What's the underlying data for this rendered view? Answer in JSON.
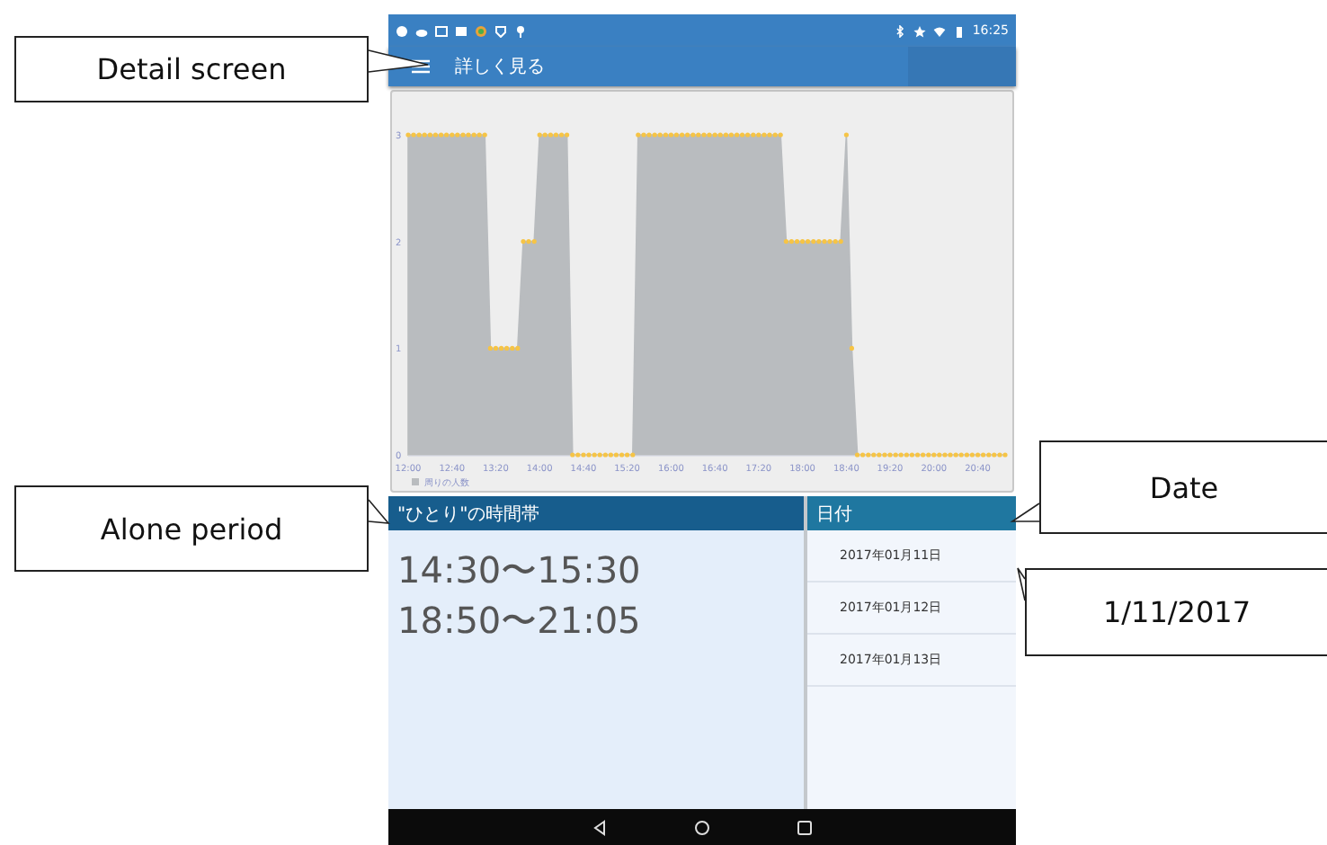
{
  "annotations": [
    {
      "text": "Detail screen"
    },
    {
      "text": "Alone period"
    },
    {
      "text": "Date"
    },
    {
      "text": "1/11/2017"
    }
  ],
  "status_bar": {
    "time": "16:25"
  },
  "app_bar": {
    "title": "詳しく見る"
  },
  "chart": {
    "chart_data": {
      "type": "area",
      "x": [
        720,
        725,
        730,
        735,
        740,
        745,
        750,
        755,
        760,
        765,
        770,
        775,
        780,
        785,
        790,
        795,
        800,
        805,
        810,
        815,
        820,
        825,
        830,
        835,
        840,
        845,
        850,
        855,
        860,
        865,
        870,
        875,
        880,
        885,
        890,
        895,
        900,
        905,
        910,
        915,
        920,
        925,
        930,
        935,
        940,
        945,
        950,
        955,
        960,
        965,
        970,
        975,
        980,
        985,
        990,
        995,
        1000,
        1005,
        1010,
        1015,
        1020,
        1025,
        1030,
        1035,
        1040,
        1045,
        1050,
        1055,
        1060,
        1065,
        1070,
        1075,
        1080,
        1085,
        1090,
        1095,
        1100,
        1105,
        1110,
        1115,
        1120,
        1125,
        1130,
        1135,
        1140,
        1145,
        1150,
        1155,
        1160,
        1165,
        1170,
        1175,
        1180,
        1185,
        1190,
        1195,
        1200,
        1205,
        1210,
        1215,
        1220,
        1225,
        1230,
        1235,
        1240,
        1245,
        1250,
        1255,
        1260,
        1265
      ],
      "series": [
        {
          "name": "周りの人数",
          "color": "#b9bcbf",
          "values": [
            3,
            3,
            3,
            3,
            3,
            3,
            3,
            3,
            3,
            3,
            3,
            3,
            3,
            3,
            3,
            1,
            1,
            1,
            1,
            1,
            1,
            2,
            2,
            2,
            3,
            3,
            3,
            3,
            3,
            3,
            0,
            0,
            0,
            0,
            0,
            0,
            0,
            0,
            0,
            0,
            0,
            0,
            3,
            3,
            3,
            3,
            3,
            3,
            3,
            3,
            3,
            3,
            3,
            3,
            3,
            3,
            3,
            3,
            3,
            3,
            3,
            3,
            3,
            3,
            3,
            3,
            3,
            3,
            3,
            2,
            2,
            2,
            2,
            2,
            2,
            2,
            2,
            2,
            2,
            2,
            3,
            1,
            0,
            0,
            0,
            0,
            0,
            0,
            0,
            0,
            0,
            0,
            0,
            0,
            0,
            0,
            0,
            0,
            0,
            0,
            0,
            0,
            0,
            0,
            0,
            0,
            0,
            0,
            0,
            0
          ]
        }
      ],
      "xlim": [
        720,
        1265
      ],
      "ylim": [
        0,
        3
      ],
      "xticks": [
        {
          "value": 720,
          "label": "12:00"
        },
        {
          "value": 760,
          "label": "12:40"
        },
        {
          "value": 800,
          "label": "13:20"
        },
        {
          "value": 840,
          "label": "14:00"
        },
        {
          "value": 880,
          "label": "14:40"
        },
        {
          "value": 920,
          "label": "15:20"
        },
        {
          "value": 960,
          "label": "16:00"
        },
        {
          "value": 1000,
          "label": "16:40"
        },
        {
          "value": 1040,
          "label": "17:20"
        },
        {
          "value": 1080,
          "label": "18:00"
        },
        {
          "value": 1120,
          "label": "18:40"
        },
        {
          "value": 1160,
          "label": "19:20"
        },
        {
          "value": 1200,
          "label": "20:00"
        },
        {
          "value": 1240,
          "label": "20:40"
        }
      ],
      "yticks": [
        0,
        1,
        2,
        3
      ]
    }
  },
  "alone_period": {
    "header": "\"ひとり\"の時間帯",
    "periods": [
      "14:30〜15:30",
      "18:50〜21:05"
    ]
  },
  "dates": {
    "header": "日付",
    "items": [
      "2017年01月11日",
      "2017年01月12日",
      "2017年01月13日"
    ]
  }
}
